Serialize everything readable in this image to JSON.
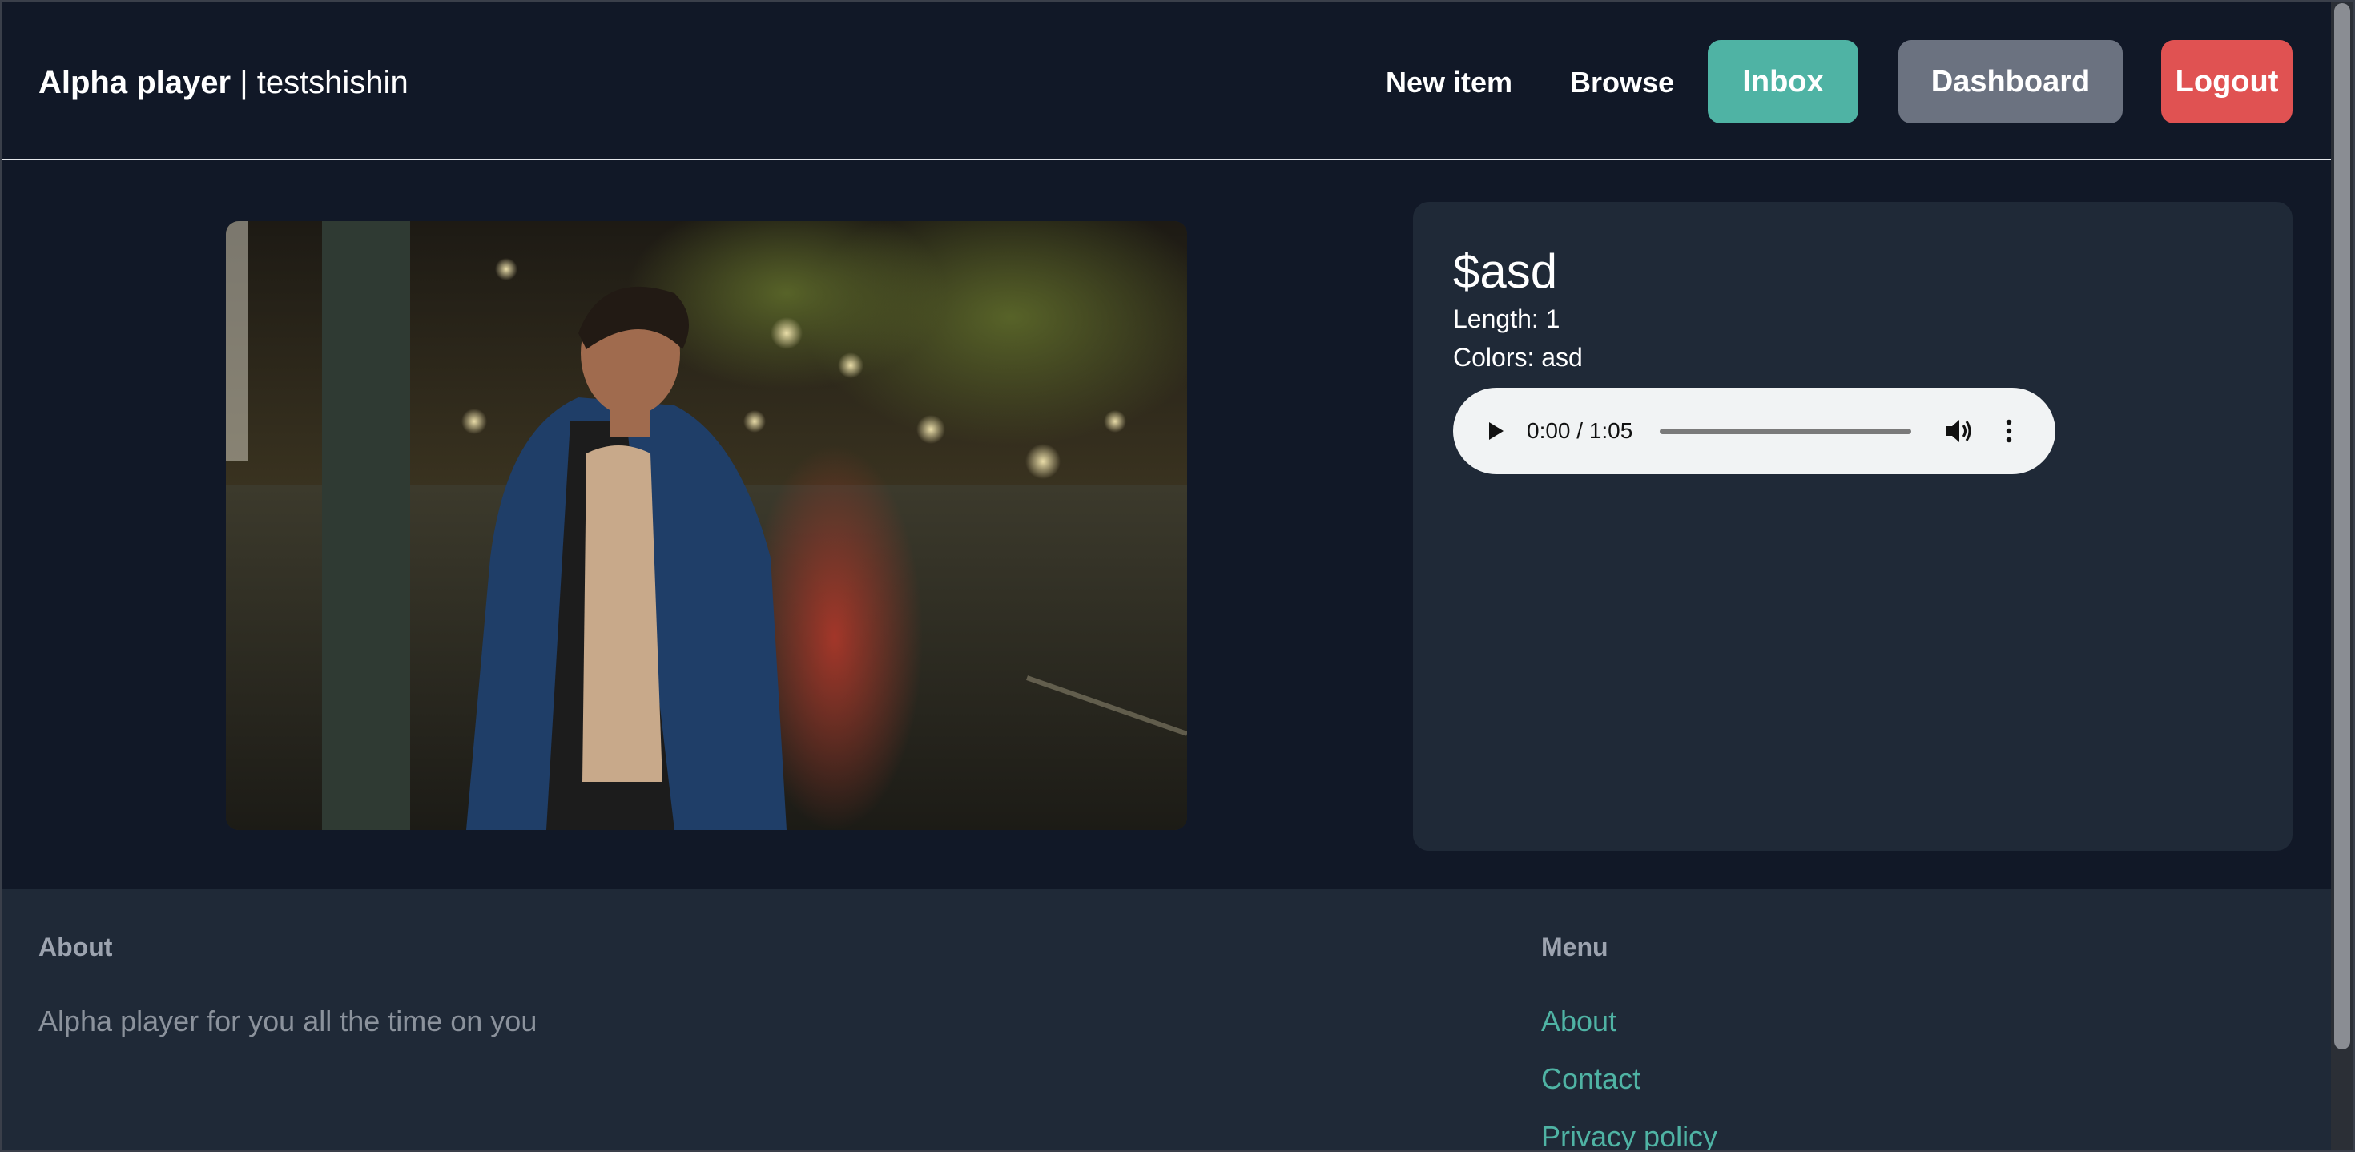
{
  "header": {
    "brand_name": "Alpha player",
    "brand_separator": " | ",
    "username": "testshishin",
    "nav_new_item": "New item",
    "nav_browse": "Browse",
    "btn_inbox": "Inbox",
    "btn_dashboard": "Dashboard",
    "btn_logout": "Logout"
  },
  "item": {
    "price": "$asd",
    "length": "Length: 1",
    "colors": "Colors: asd",
    "audio": {
      "time": "0:00 / 1:05",
      "progress_fraction": 0
    }
  },
  "footer": {
    "about_heading": "About",
    "about_text": "Alpha player for you all the time on you",
    "menu_heading": "Menu",
    "links": [
      "About",
      "Contact",
      "Privacy policy"
    ]
  },
  "colors": {
    "background": "#111827",
    "card": "#1f2937",
    "accent": "#4fb3a4",
    "dashboard_btn": "#6b7280",
    "logout_btn": "#e05252"
  },
  "icons": {
    "play": "play-icon",
    "volume": "volume-icon",
    "more": "more-vertical-icon"
  }
}
